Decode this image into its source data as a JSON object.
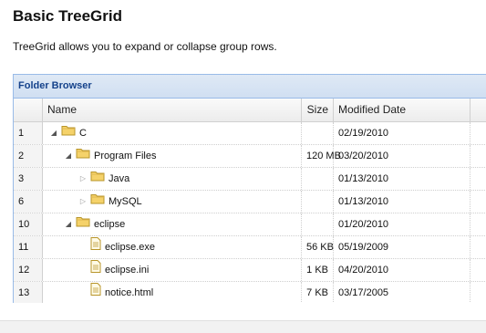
{
  "page": {
    "title": "Basic TreeGrid",
    "description": "TreeGrid allows you to expand or collapse group rows."
  },
  "panel": {
    "title": "Folder Browser"
  },
  "columns": {
    "name": "Name",
    "size": "Size",
    "date": "Modified Date"
  },
  "rows": [
    {
      "id": "1",
      "level": 0,
      "type": "folder",
      "state": "expanded",
      "name": "C",
      "size": "",
      "date": "02/19/2010"
    },
    {
      "id": "2",
      "level": 1,
      "type": "folder",
      "state": "expanded",
      "name": "Program Files",
      "size": "120 MB",
      "date": "03/20/2010"
    },
    {
      "id": "3",
      "level": 2,
      "type": "folder",
      "state": "collapsed",
      "name": "Java",
      "size": "",
      "date": "01/13/2010"
    },
    {
      "id": "6",
      "level": 2,
      "type": "folder",
      "state": "collapsed",
      "name": "MySQL",
      "size": "",
      "date": "01/13/2010"
    },
    {
      "id": "10",
      "level": 1,
      "type": "folder",
      "state": "expanded",
      "name": "eclipse",
      "size": "",
      "date": "01/20/2010"
    },
    {
      "id": "11",
      "level": 2,
      "type": "file",
      "state": "leaf",
      "name": "eclipse.exe",
      "size": "56 KB",
      "date": "05/19/2009"
    },
    {
      "id": "12",
      "level": 2,
      "type": "file",
      "state": "leaf",
      "name": "eclipse.ini",
      "size": "1 KB",
      "date": "04/20/2010"
    },
    {
      "id": "13",
      "level": 2,
      "type": "file",
      "state": "leaf",
      "name": "notice.html",
      "size": "7 KB",
      "date": "03/17/2005"
    }
  ],
  "colors": {
    "panel_border": "#99bbe8",
    "panel_title": "#15428b",
    "folder": "#f5d26a"
  }
}
